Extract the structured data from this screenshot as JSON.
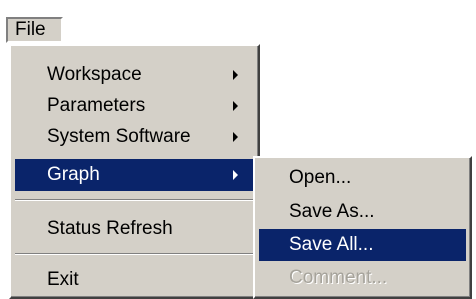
{
  "menubar": {
    "file_label": "File"
  },
  "main_menu": {
    "items": [
      {
        "label": "Workspace",
        "has_submenu": true
      },
      {
        "label": "Parameters",
        "has_submenu": true
      },
      {
        "label": "System Software",
        "has_submenu": true
      },
      {
        "label": "Graph",
        "has_submenu": true,
        "highlighted": true
      },
      {
        "label": "Status Refresh",
        "has_submenu": false
      },
      {
        "label": "Exit",
        "has_submenu": false
      }
    ]
  },
  "graph_submenu": {
    "items": [
      {
        "label": "Open..."
      },
      {
        "label": "Save As..."
      },
      {
        "label": "Save All...",
        "highlighted": true
      },
      {
        "label": "Comment...",
        "disabled": true
      }
    ]
  },
  "colors": {
    "menu_bg": "#d4d0c8",
    "highlight_bg": "#0a246a",
    "highlight_fg": "#ffffff",
    "disabled_fg": "#a6a39b"
  }
}
